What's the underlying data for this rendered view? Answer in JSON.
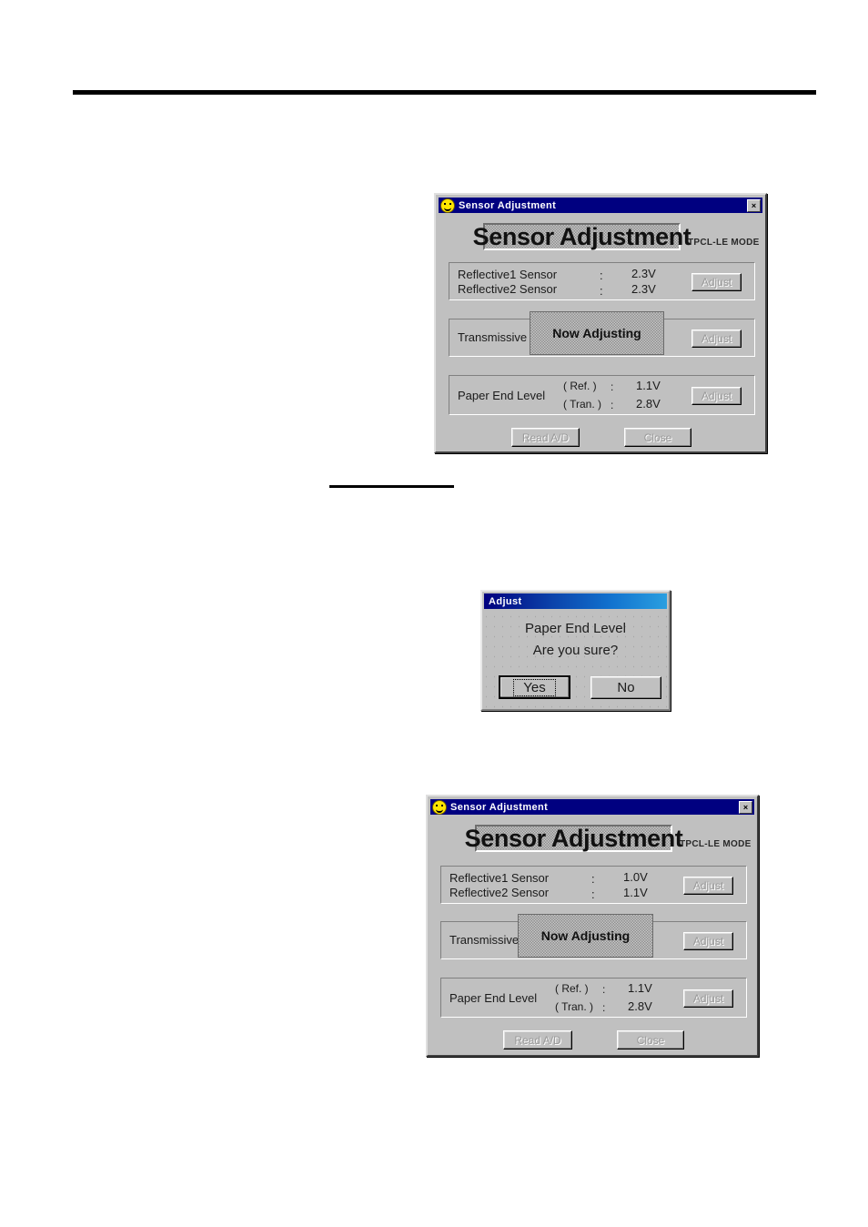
{
  "page": {
    "rule": "horizontal-rule",
    "short_rule": "caption-underline"
  },
  "dialog_top": {
    "titlebar": {
      "icon": "smiley-face-icon",
      "title": "Sensor Adjustment",
      "close_label": "×"
    },
    "header": {
      "title": "Sensor Adjustment",
      "mode": "TPCL-LE MODE"
    },
    "group_reflective": {
      "rows": [
        {
          "label": "Reflective1 Sensor",
          "sep": ":",
          "value": "2.3V"
        },
        {
          "label": "Reflective2 Sensor",
          "sep": ":",
          "value": "2.3V"
        }
      ],
      "adjust_label": "Adjust"
    },
    "group_transmissive": {
      "label": "Transmissive",
      "adjust_label": "Adjust"
    },
    "group_paper_end": {
      "label": "Paper End Level",
      "rows": [
        {
          "label": "( Ref.  )",
          "sep": ":",
          "value": "1.1V"
        },
        {
          "label": "( Tran. )",
          "sep": ":",
          "value": "2.8V"
        }
      ],
      "adjust_label": "Adjust"
    },
    "overlay": {
      "text": "Now  Adjusting"
    },
    "footer": {
      "read_ad_label": "Read A/D",
      "close_label": "Close"
    }
  },
  "dialog_confirm": {
    "titlebar": {
      "title": "Adjust"
    },
    "message_line1": "Paper  End  Level",
    "message_line2": "Are you sure?",
    "yes_label": "Yes",
    "no_label": "No"
  },
  "dialog_bottom": {
    "titlebar": {
      "icon": "smiley-face-icon",
      "title": "Sensor Adjustment",
      "close_label": "×"
    },
    "header": {
      "title": "Sensor Adjustment",
      "mode": "TPCL-LE MODE"
    },
    "group_reflective": {
      "rows": [
        {
          "label": "Reflective1 Sensor",
          "sep": ":",
          "value": "1.0V"
        },
        {
          "label": "Reflective2 Sensor",
          "sep": ":",
          "value": "1.1V"
        }
      ],
      "adjust_label": "Adjust"
    },
    "group_transmissive": {
      "label": "Transmissive",
      "adjust_label": "Adjust"
    },
    "group_paper_end": {
      "label": "Paper End Level",
      "rows": [
        {
          "label": "( Ref.  )",
          "sep": ":",
          "value": "1.1V"
        },
        {
          "label": "( Tran. )",
          "sep": ":",
          "value": "2.8V"
        }
      ],
      "adjust_label": "Adjust"
    },
    "overlay": {
      "text": "Now  Adjusting"
    },
    "footer": {
      "read_ad_label": "Read A/D",
      "close_label": "Close"
    }
  },
  "colors": {
    "titlebar": "#000080",
    "dialog_face": "#c0c0c0",
    "shadow": "#808080",
    "highlight": "#ffffff",
    "disabled_text": "#9a9a9a"
  }
}
